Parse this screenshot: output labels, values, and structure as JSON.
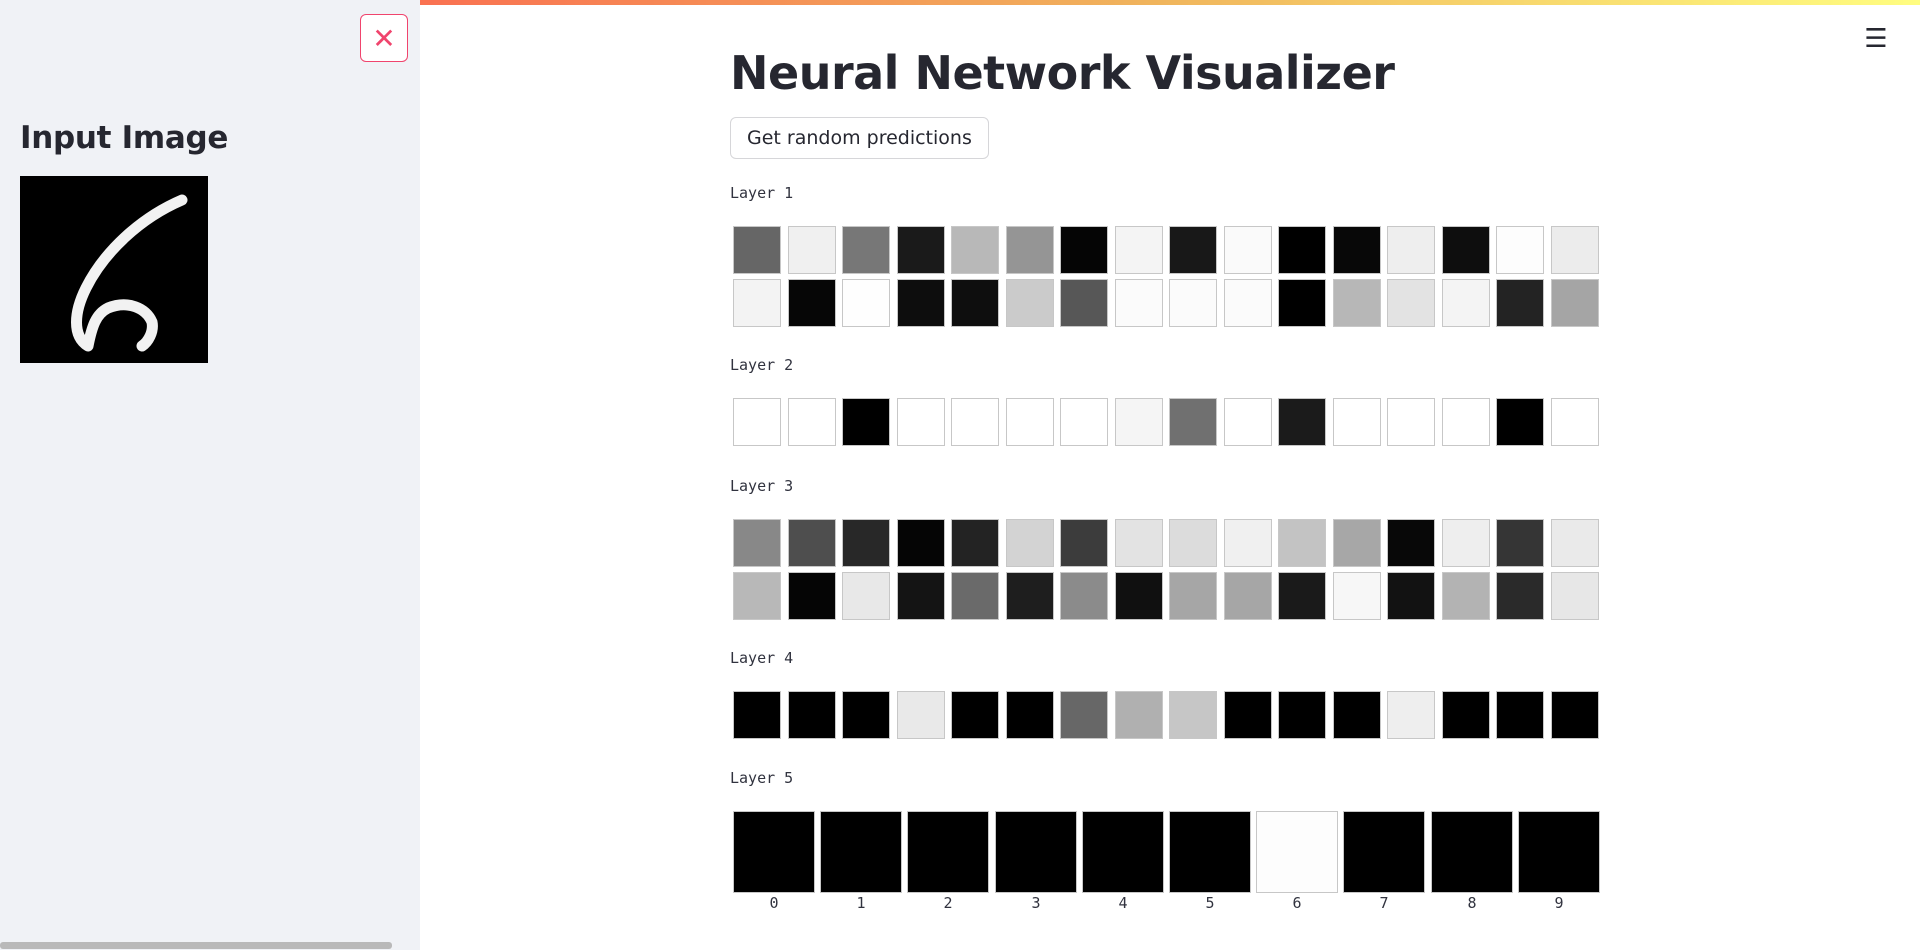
{
  "sidebar": {
    "close_icon": "close-x-icon",
    "accent_color": "#f0446d",
    "heading": "Input Image",
    "input_image": "handwritten-digit-6"
  },
  "header": {
    "menu_icon": "hamburger-menu-icon"
  },
  "main": {
    "title": "Neural Network Visualizer",
    "button_label": "Get random predictions",
    "layers": [
      {
        "label": "Layer 1",
        "rows": [
          [
            "#666666",
            "#f0f0f0",
            "#777777",
            "#1a1a1a",
            "#b8b8b8",
            "#959595",
            "#050505",
            "#f4f4f4",
            "#181818",
            "#fafafa",
            "#000000",
            "#080808",
            "#eeeeee",
            "#0e0e0e",
            "#fdfdfd",
            "#ececec"
          ],
          [
            "#f3f3f3",
            "#060606",
            "#fefefe",
            "#0d0d0d",
            "#0e0e0e",
            "#cbcbcb",
            "#575757",
            "#fbfbfb",
            "#fbfbfb",
            "#fbfbfb",
            "#000000",
            "#b7b7b7",
            "#e3e3e3",
            "#f4f4f4",
            "#232323",
            "#a5a5a5"
          ]
        ]
      },
      {
        "label": "Layer 2",
        "rows": [
          [
            "#ffffff",
            "#ffffff",
            "#000000",
            "#ffffff",
            "#ffffff",
            "#ffffff",
            "#ffffff",
            "#f5f5f5",
            "#707070",
            "#ffffff",
            "#1b1b1b",
            "#ffffff",
            "#ffffff",
            "#ffffff",
            "#000000",
            "#ffffff"
          ]
        ]
      },
      {
        "label": "Layer 3",
        "rows": [
          [
            "#888888",
            "#4e4e4e",
            "#282828",
            "#050505",
            "#232323",
            "#d3d3d3",
            "#3c3c3c",
            "#e3e3e3",
            "#dcdcdc",
            "#f0f0f0",
            "#c3c3c3",
            "#a7a7a7",
            "#080808",
            "#eeeeee",
            "#353535",
            "#eaeaea"
          ],
          [
            "#b8b8b8",
            "#050505",
            "#e8e8e8",
            "#141414",
            "#6a6a6a",
            "#1e1e1e",
            "#8b8b8b",
            "#101010",
            "#a6a6a6",
            "#a6a6a6",
            "#1a1a1a",
            "#f7f7f7",
            "#121212",
            "#b3b3b3",
            "#2a2a2a",
            "#e7e7e7"
          ]
        ]
      },
      {
        "label": "Layer 4",
        "rows": [
          [
            "#000000",
            "#000000",
            "#000000",
            "#e9e9e9",
            "#000000",
            "#000000",
            "#676767",
            "#b0b0b0",
            "#c6c6c6",
            "#000000",
            "#000000",
            "#000000",
            "#eeeeee",
            "#000000",
            "#000000",
            "#000000"
          ]
        ]
      }
    ],
    "output_layer": {
      "label": "Layer 5",
      "cells": [
        "#000000",
        "#000000",
        "#000000",
        "#000000",
        "#000000",
        "#000000",
        "#fdfdfd",
        "#000000",
        "#000000",
        "#000000"
      ],
      "digits": [
        "0",
        "1",
        "2",
        "3",
        "4",
        "5",
        "6",
        "7",
        "8",
        "9"
      ]
    }
  }
}
